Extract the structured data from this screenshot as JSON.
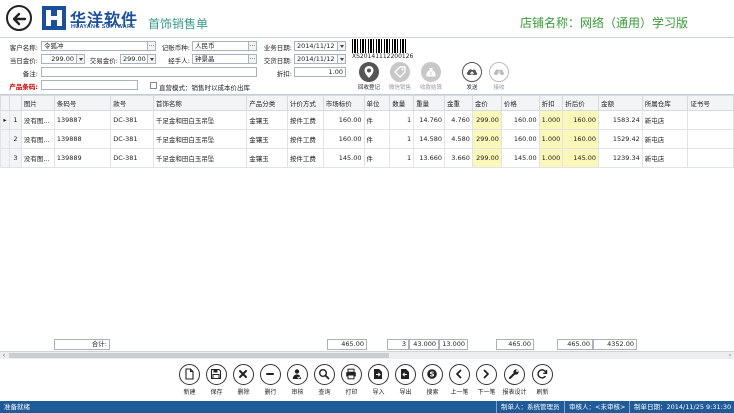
{
  "header": {
    "brand_name": "华洋软件",
    "brand_sub": "HUAYANG SOFTWARE",
    "doc_title": "首饰销售单",
    "shop_name": "店铺名称：网络（通用）学习版"
  },
  "form": {
    "customer_label": "客户名称:",
    "customer_value": "令狐冲",
    "currency_label": "记账币种:",
    "currency_value": "人民币",
    "biz_date_label": "业务日期:",
    "biz_date_value": "2014/11/12",
    "gold_price_label": "当日金价:",
    "gold_price_value": "299.00",
    "trade_price_label": "交易金价:",
    "trade_price_value": "299.00",
    "handler_label": "经手人:",
    "handler_value": "钟景晶",
    "deliver_date_label": "交货日期:",
    "deliver_date_value": "2014/11/12",
    "discount_label": "折扣:",
    "discount_value": "1.00",
    "remark_label": "备注:",
    "remark_value": "",
    "barcode_label": "产品条码:",
    "barcode_input": "",
    "direct_mode_label": "直营模式：销售时以成本价出库",
    "barcode_number": "XS20141112200126"
  },
  "quick_actions": [
    {
      "label": "回收登记",
      "icon": "location-pin-icon",
      "style": "dark"
    },
    {
      "label": "微信销售",
      "icon": "tag-icon",
      "style": "light"
    },
    {
      "label": "收款结算",
      "icon": "money-bag-icon",
      "style": "light"
    },
    {
      "label": "发送",
      "icon": "cloud-upload-icon",
      "style": "outline"
    },
    {
      "label": "接收",
      "icon": "cloud-download-icon",
      "style": "outline-light"
    }
  ],
  "table": {
    "columns": [
      "图片",
      "条码号",
      "款号",
      "首饰名称",
      "产品分类",
      "计价方式",
      "市场标价",
      "单位",
      "数量",
      "重量",
      "金重",
      "金价",
      "价格",
      "折扣",
      "折后价",
      "金额",
      "所属仓库",
      "证书号"
    ],
    "rows": [
      {
        "idx": "1",
        "marker": "▸",
        "img": "没有图...",
        "barcode": "139887",
        "style": "DC-381",
        "name": "千足金和田白玉吊坠",
        "category": "金镶玉",
        "pricing": "按件工费",
        "market": "160.00",
        "unit": "件",
        "qty": "1",
        "weight": "14.760",
        "gold_weight": "4.760",
        "gold_price": "299.00",
        "price": "160.00",
        "discount": "1.000",
        "disc_price": "160.00",
        "amount": "1583.24",
        "warehouse": "新屯店",
        "cert": ""
      },
      {
        "idx": "2",
        "marker": "",
        "img": "没有图...",
        "barcode": "139888",
        "style": "DC-381",
        "name": "千足金和田白玉吊坠",
        "category": "金镶玉",
        "pricing": "按件工费",
        "market": "160.00",
        "unit": "件",
        "qty": "1",
        "weight": "14.580",
        "gold_weight": "4.580",
        "gold_price": "299.00",
        "price": "160.00",
        "discount": "1.000",
        "disc_price": "160.00",
        "amount": "1529.42",
        "warehouse": "新屯店",
        "cert": ""
      },
      {
        "idx": "3",
        "marker": "",
        "img": "没有图...",
        "barcode": "139889",
        "style": "DC-381",
        "name": "千足金和田白玉吊坠",
        "category": "金镶玉",
        "pricing": "按件工费",
        "market": "145.00",
        "unit": "件",
        "qty": "1",
        "weight": "13.660",
        "gold_weight": "3.660",
        "gold_price": "299.00",
        "price": "145.00",
        "discount": "1.000",
        "disc_price": "145.00",
        "amount": "1239.34",
        "warehouse": "新屯店",
        "cert": ""
      }
    ],
    "summary": {
      "label": "合计:",
      "market": "465.00",
      "qty": "3",
      "weight": "43.000",
      "gold_weight": "13.000",
      "price": "465.00",
      "disc_price": "465.00",
      "amount": "4352.00"
    }
  },
  "toolbar": [
    {
      "label": "新建",
      "icon": "new-document-icon"
    },
    {
      "label": "保存",
      "icon": "floppy-disk-icon"
    },
    {
      "label": "删除",
      "icon": "delete-x-icon"
    },
    {
      "label": "删行",
      "icon": "minus-icon"
    },
    {
      "label": "审核",
      "icon": "user-check-icon"
    },
    {
      "label": "查询",
      "icon": "magnifier-icon"
    },
    {
      "label": "打印",
      "icon": "printer-icon"
    },
    {
      "label": "导入",
      "icon": "import-icon"
    },
    {
      "label": "导出",
      "icon": "export-icon"
    },
    {
      "label": "搜索",
      "icon": "skype-search-icon"
    },
    {
      "label": "上一笔",
      "icon": "chevron-left-icon"
    },
    {
      "label": "下一笔",
      "icon": "chevron-right-icon"
    },
    {
      "label": "报表设计",
      "icon": "wrench-icon"
    },
    {
      "label": "刷新",
      "icon": "refresh-icon"
    }
  ],
  "status": {
    "ready": "准备就绪",
    "maker": "制单人：系统管理员",
    "auditor": "审核人：<未审核>",
    "made_date": "制单日期：2014/11/25 9:31:30"
  },
  "colors": {
    "brand_blue": "#1b4f9c",
    "title_teal": "#3a9a8a",
    "shop_green": "#3a9a3a",
    "highlight_yellow": "#fbf7b8",
    "status_bar": "#1f5b98"
  }
}
